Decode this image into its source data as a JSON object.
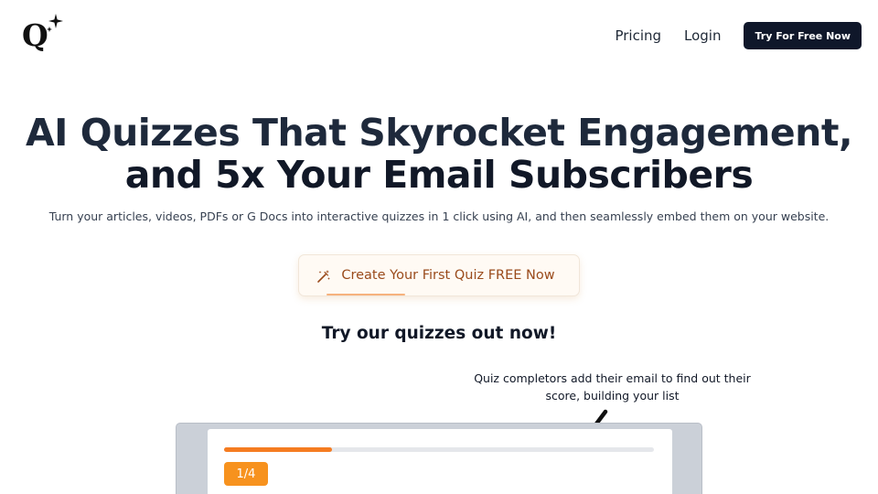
{
  "header": {
    "logo_letter": "Q",
    "nav": {
      "pricing_label": "Pricing",
      "login_label": "Login",
      "cta_label": "Try For Free Now"
    }
  },
  "hero": {
    "title_line1": "AI Quizzes That Skyrocket Engagement,",
    "title_line2": "and 5x Your Email Subscribers",
    "subtitle": "Turn your articles, videos, PDFs or G Docs into interactive quizzes in 1 click using AI, and then seamlessly embed them on your website.",
    "cta_label": "Create Your First Quiz FREE Now",
    "cta_icon": "magic-wand-icon"
  },
  "demo": {
    "heading": "Try our quizzes out now!",
    "annotation": "Quiz completors add their email to find out their score, building your list",
    "quiz": {
      "step_label": "1/4",
      "progress_fraction": 0.25
    }
  },
  "colors": {
    "nav_cta_bg": "#0f172a",
    "hero_cta_text": "#9a4b1c",
    "progress_fill": "#f57c21",
    "badge_bg": "#f7921e"
  }
}
